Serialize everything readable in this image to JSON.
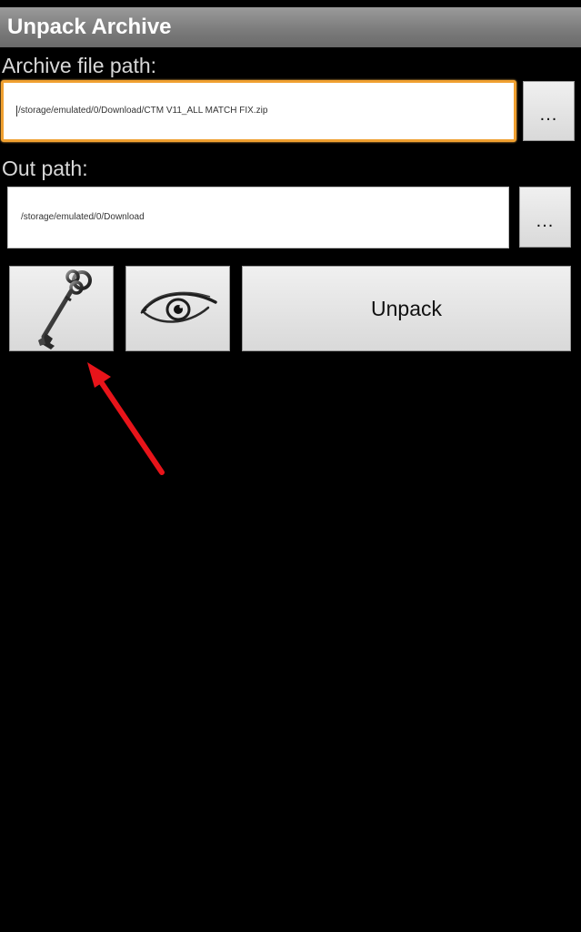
{
  "window": {
    "title": "Unpack Archive"
  },
  "archive": {
    "label": "Archive file path:",
    "value": "/storage/emulated/0/Download/CTM V11_ALL MATCH FIX.zip",
    "browse_label": "..."
  },
  "out": {
    "label": "Out path:",
    "value": "/storage/emulated/0/Download",
    "browse_label": "..."
  },
  "actions": {
    "password_icon": "key-icon",
    "view_icon": "eye-icon",
    "unpack_label": "Unpack"
  },
  "annotation": {
    "arrow_color": "#e8141a",
    "target": "password-button"
  },
  "colors": {
    "focus_border": "#f0a030",
    "title_bar": "#8a8a8a",
    "background": "#000000"
  }
}
